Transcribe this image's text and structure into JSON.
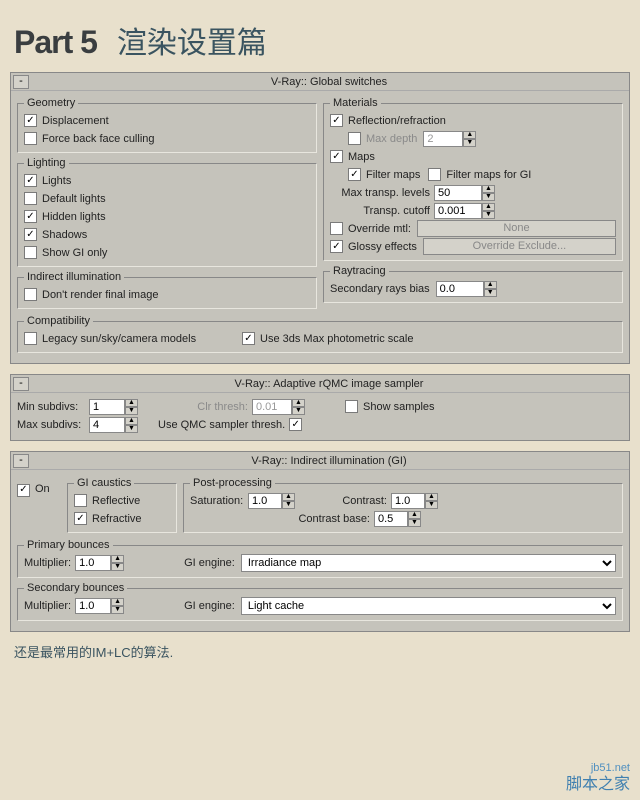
{
  "header": {
    "part": "Part 5",
    "title": "渲染设置篇"
  },
  "globalSwitches": {
    "rollout": "V-Ray:: Global switches",
    "geometry": {
      "legend": "Geometry",
      "displacement": "Displacement",
      "forceBack": "Force back face culling"
    },
    "lighting": {
      "legend": "Lighting",
      "lights": "Lights",
      "defaultLights": "Default lights",
      "hiddenLights": "Hidden lights",
      "shadows": "Shadows",
      "showGI": "Show GI only"
    },
    "indirect": {
      "legend": "Indirect illumination",
      "dontRender": "Don't render final image"
    },
    "compat": {
      "legend": "Compatibility",
      "legacy": "Legacy sun/sky/camera models",
      "photometric": "Use 3ds Max photometric scale"
    },
    "materials": {
      "legend": "Materials",
      "reflRefr": "Reflection/refraction",
      "maxDepth": "Max depth",
      "maxDepthVal": "2",
      "maps": "Maps",
      "filterMaps": "Filter maps",
      "filterGI": "Filter maps for GI",
      "maxTransp": "Max transp. levels",
      "maxTranspVal": "50",
      "transpCut": "Transp. cutoff",
      "transpCutVal": "0.001",
      "override": "Override mtl:",
      "overrideBtn": "None",
      "glossy": "Glossy effects",
      "excludeBtn": "Override Exclude..."
    },
    "raytracing": {
      "legend": "Raytracing",
      "secRays": "Secondary rays bias",
      "secRaysVal": "0.0"
    }
  },
  "sampler": {
    "rollout": "V-Ray:: Adaptive rQMC image sampler",
    "minSub": "Min subdivs:",
    "minVal": "1",
    "maxSub": "Max subdivs:",
    "maxVal": "4",
    "clrThresh": "Clr thresh:",
    "clrVal": "0.01",
    "useQMC": "Use QMC sampler thresh.",
    "showSamples": "Show samples"
  },
  "gi": {
    "rollout": "V-Ray:: Indirect illumination (GI)",
    "on": "On",
    "caustics": {
      "legend": "GI caustics",
      "reflective": "Reflective",
      "refractive": "Refractive"
    },
    "post": {
      "legend": "Post-processing",
      "saturation": "Saturation:",
      "satVal": "1.0",
      "contrast": "Contrast:",
      "conVal": "1.0",
      "contrastBase": "Contrast base:",
      "cbVal": "0.5"
    },
    "primary": {
      "legend": "Primary bounces",
      "mult": "Multiplier:",
      "multVal": "1.0",
      "engine": "GI engine:",
      "engineVal": "Irradiance map"
    },
    "secondary": {
      "legend": "Secondary bounces",
      "mult": "Multiplier:",
      "multVal": "1.0",
      "engine": "GI engine:",
      "engineVal": "Light cache"
    }
  },
  "caption": "还是最常用的IM+LC的算法.",
  "watermark": {
    "l1": "jb51.net",
    "l2": "脚本之家"
  }
}
